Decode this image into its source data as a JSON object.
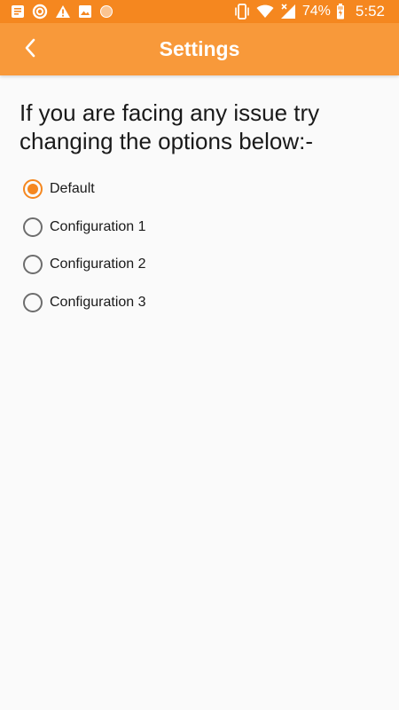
{
  "status_bar": {
    "battery_percent": "74%",
    "time": "5:52",
    "left_icons": [
      "notes-icon",
      "sync-ring-icon",
      "warning-icon",
      "image-icon",
      "dot-icon"
    ],
    "right_icons": [
      "vibrate-icon",
      "wifi-icon",
      "signal-icon",
      "battery-icon"
    ]
  },
  "app_bar": {
    "title": "Settings",
    "back_icon": "chevron-left-icon"
  },
  "main": {
    "instructions": "If you are facing any issue try changing the options below:-",
    "options": [
      {
        "label": "Default",
        "selected": true
      },
      {
        "label": "Configuration 1",
        "selected": false
      },
      {
        "label": "Configuration 2",
        "selected": false
      },
      {
        "label": "Configuration 3",
        "selected": false
      }
    ]
  },
  "colors": {
    "status_bar": "#f5871f",
    "app_bar": "#f8993a",
    "accent": "#f5871f",
    "background": "#fafafa"
  }
}
